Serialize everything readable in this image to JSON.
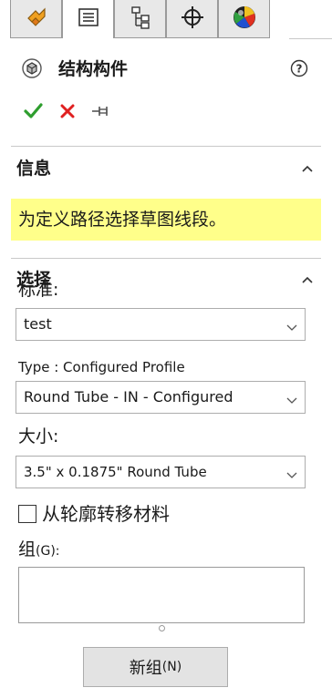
{
  "tabs": [
    {
      "name": "feature-manager",
      "icon": "feature-tree-icon"
    },
    {
      "name": "property-manager",
      "icon": "property-manager-icon"
    },
    {
      "name": "configuration-manager",
      "icon": "configuration-manager-icon"
    },
    {
      "name": "dimxpert-manager",
      "icon": "dimxpert-icon"
    },
    {
      "name": "display-manager",
      "icon": "appearance-icon"
    }
  ],
  "active_tab_index": 1,
  "panel": {
    "title": "结构构件",
    "title_icon": "structure-member-icon",
    "help_icon": "help-icon"
  },
  "actions": {
    "ok_icon": "checkmark-icon",
    "ok_color": "#2e9e2e",
    "cancel_icon": "close-icon",
    "cancel_color": "#e02020",
    "pin_icon": "pushpin-icon"
  },
  "info_section": {
    "header": "信息",
    "message": "为定义路径选择草图线段。",
    "message_bg": "#ffff8a"
  },
  "selection_section": {
    "header": "选择",
    "standard_label": "标准:",
    "standard_value": "test",
    "type_label": "Type : Configured Profile",
    "type_value": "Round Tube - IN - Configured",
    "size_label": "大小:",
    "size_value": "3.5\" x 0.1875\" Round Tube",
    "transfer_material_label": "从轮廓转移材料",
    "transfer_material_checked": false,
    "groups_label": "组",
    "groups_shortcut": "(G):",
    "new_group_label": "新组",
    "new_group_shortcut": "(N)"
  }
}
